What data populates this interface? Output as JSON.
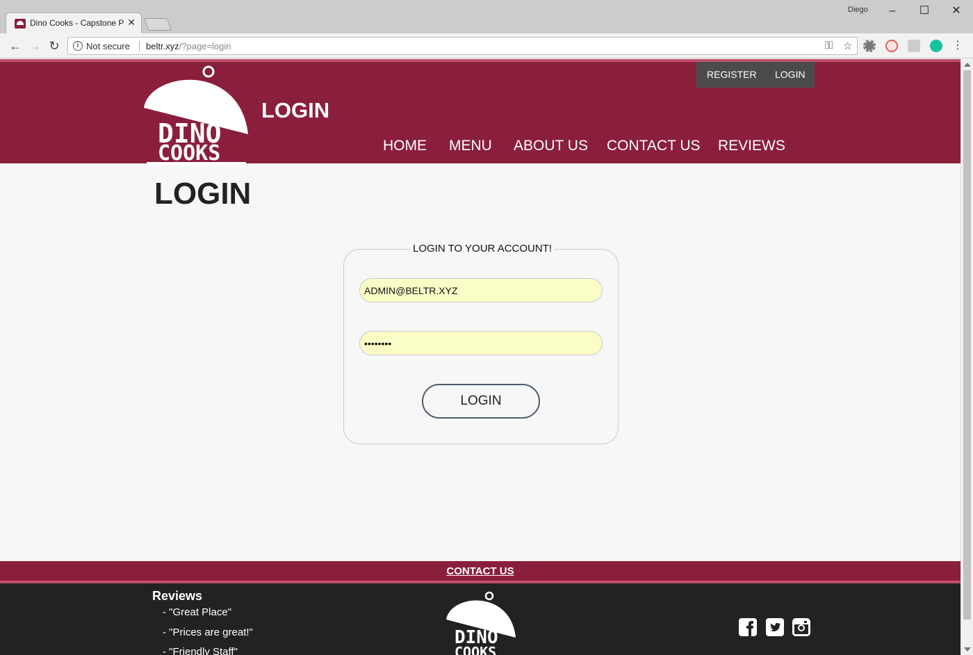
{
  "browser": {
    "tab_title": "Dino Cooks - Capstone P",
    "user_name": "Diego",
    "security_label": "Not secure",
    "url_host": "beltr.xyz",
    "url_path": "/?page=login"
  },
  "header": {
    "logo_text_top": "DINO",
    "logo_text_bottom": "COOKS",
    "page_label": "LOGIN",
    "auth": {
      "register": "REGISTER",
      "login": "LOGIN"
    },
    "nav": [
      "HOME",
      "MENU",
      "ABOUT US",
      "CONTACT US",
      "REVIEWS"
    ],
    "brand_color": "#8a1f3c"
  },
  "main": {
    "heading": "LOGIN",
    "form": {
      "legend": "LOGIN TO YOUR ACCOUNT!",
      "email_value": "ADMIN@BELTR.XYZ",
      "password_value": "••••••••",
      "submit_label": "LOGIN"
    }
  },
  "footer": {
    "contact_link": "CONTACT US",
    "reviews_title": "Reviews",
    "reviews": [
      "- \"Great Place\"",
      "- \"Prices are great!\"",
      "- \"Friendly Staff\""
    ],
    "logo_text_top": "DINO",
    "logo_text_bottom": "COOKS",
    "social_icons": [
      "facebook-icon",
      "twitter-icon",
      "instagram-icon"
    ]
  }
}
